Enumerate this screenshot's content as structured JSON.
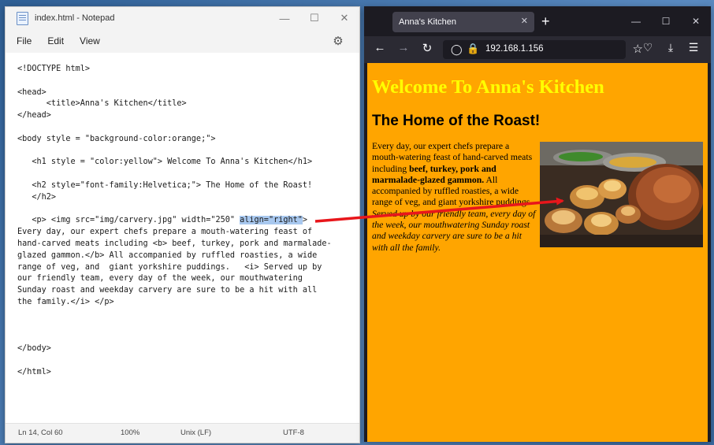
{
  "notepad": {
    "title": "index.html - Notepad",
    "menu": [
      "File",
      "Edit",
      "View"
    ],
    "code_before_selection": "<!DOCTYPE html>\n\n<head>\n      <title>Anna's Kitchen</title>\n</head>\n\n<body style = \"background-color:orange;\">\n\n   <h1 style = \"color:yellow\"> Welcome To Anna's Kitchen</h1>\n\n   <h2 style=\"font-family:Helvetica;\"> The Home of the Roast!\n   </h2>\n\n   <p> <img src=\"img/carvery.jpg\" width=\"250\" ",
    "code_selected": "align=\"right\"",
    "code_after_selection": ">\nEvery day, our expert chefs prepare a mouth-watering feast of\nhand-carved meats including <b> beef, turkey, pork and marmalade-\nglazed gammon.</b> All accompanied by ruffled roasties, a wide\nrange of veg, and  giant yorkshire puddings.   <i> Served up by\nour friendly team, every day of the week, our mouthwatering\nSunday roast and weekday carvery are sure to be a hit with all\nthe family.</i> </p>\n\n\n\n</body>\n\n</html>",
    "status": {
      "position": "Ln 14, Col 60",
      "zoom": "100%",
      "line_ending": "Unix (LF)",
      "encoding": "UTF-8"
    }
  },
  "browser": {
    "tab_title": "Anna's Kitchen",
    "url": "192.168.1.156",
    "page": {
      "h1": "Welcome To Anna's Kitchen",
      "h2": "The Home of the Roast!",
      "p_intro": "Every day, our expert chefs prepare a mouth-watering feast of hand-carved meats including ",
      "p_bold": "beef, turkey, pork and marmalade-glazed gammon.",
      "p_middle": " All accompanied by ruffled roasties, a wide range of veg, and giant yorkshire puddings. ",
      "p_italic": "Served up by our friendly team, every day of the week, our mouthwatering Sunday roast and weekday carvery are sure to be a hit with all the family."
    }
  },
  "colors": {
    "page_background": "#ffa500",
    "heading_yellow": "#ffff00",
    "arrow": "#e8161b",
    "selection": "#a8c8ef"
  },
  "icons": {
    "notepad": [
      "notepad-app-icon",
      "minimize-icon",
      "maximize-icon",
      "close-icon",
      "settings-gear-icon"
    ],
    "browser": [
      "tab-close-icon",
      "new-tab-icon",
      "back-icon",
      "forward-icon",
      "reload-icon",
      "shield-icon",
      "lock-warning-icon",
      "bookmark-star-icon",
      "pocket-icon",
      "download-icon",
      "menu-icon"
    ]
  }
}
